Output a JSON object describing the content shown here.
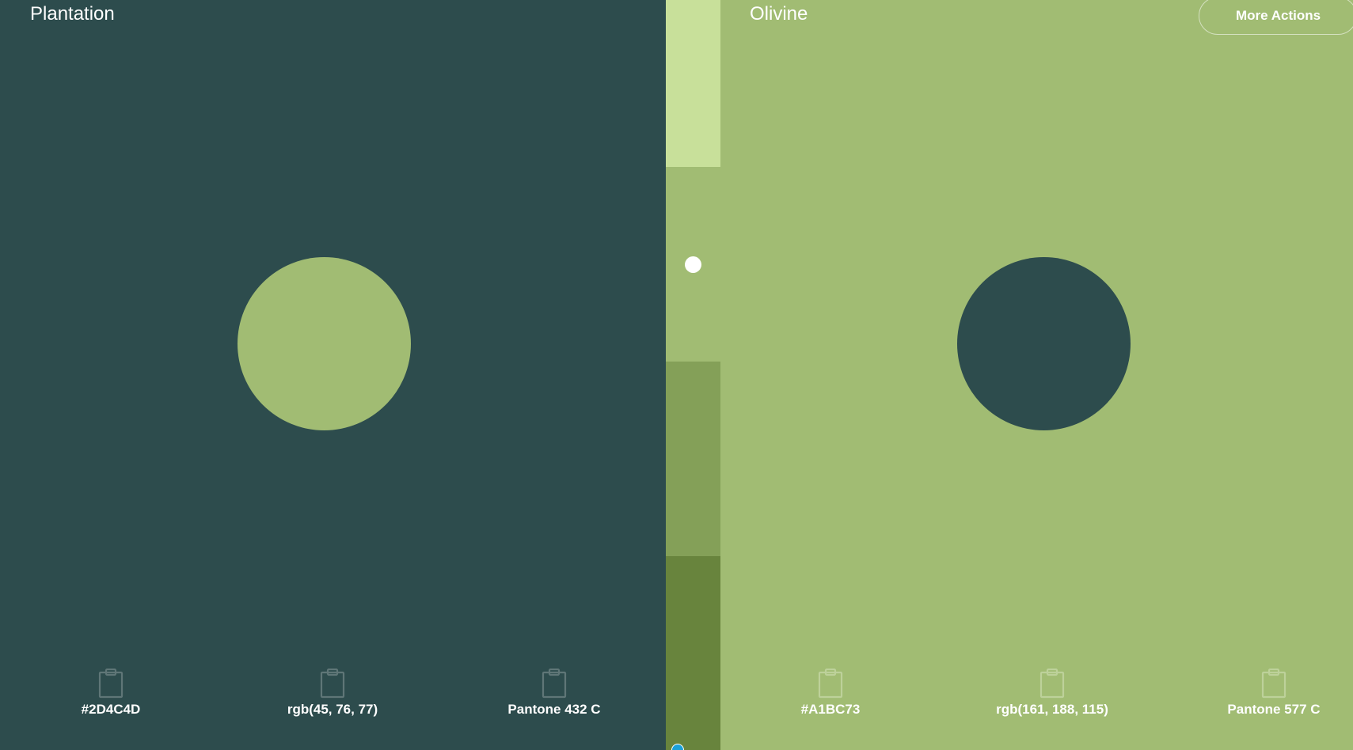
{
  "left_panel": {
    "name": "Plantation",
    "background": "#2D4C4D",
    "circle_color": "#A1BC73",
    "values": [
      {
        "label": "#2D4C4D",
        "icon": "clipboard-icon"
      },
      {
        "label": "rgb(45, 76, 77)",
        "icon": "clipboard-icon"
      },
      {
        "label": "Pantone 432 C",
        "icon": "clipboard-icon"
      }
    ],
    "icon_color": "#5f7677"
  },
  "right_panel": {
    "name": "Olivine",
    "background": "#A1BC73",
    "circle_color": "#2D4C4D",
    "values": [
      {
        "label": "#A1BC73",
        "icon": "clipboard-icon"
      },
      {
        "label": "rgb(161, 188, 115)",
        "icon": "clipboard-icon"
      },
      {
        "label": "Pantone 577 C",
        "icon": "clipboard-icon"
      }
    ],
    "icon_color": "#bdd19a"
  },
  "shades": {
    "colors": [
      "#C8E09A",
      "#A1BC73",
      "#84A058",
      "#68843D"
    ],
    "selected_index": 1,
    "selected_dot_color": "#ffffff",
    "scroll_indicator_color": "#1aa0d8"
  },
  "actions": {
    "more_actions_label": "More Actions"
  }
}
